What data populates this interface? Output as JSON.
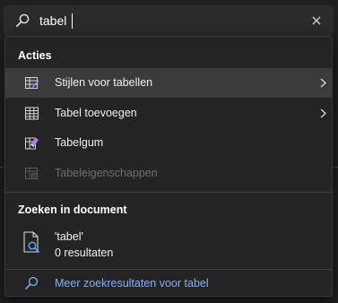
{
  "search": {
    "value": "tabel",
    "icon": "search-icon",
    "clear_icon": "close-icon"
  },
  "sections": {
    "actions_title": "Acties",
    "document_title": "Zoeken in document"
  },
  "actions": [
    {
      "label": "Stijlen voor tabellen",
      "icon": "table-styles-icon",
      "has_submenu": true,
      "hovered": true,
      "disabled": false
    },
    {
      "label": "Tabel toevoegen",
      "icon": "table-grid-icon",
      "has_submenu": true,
      "hovered": false,
      "disabled": false
    },
    {
      "label": "Tabelgum",
      "icon": "table-eraser-icon",
      "has_submenu": false,
      "hovered": false,
      "disabled": false
    },
    {
      "label": "Tabeleigenschappen",
      "icon": "table-properties-icon",
      "has_submenu": false,
      "hovered": false,
      "disabled": true
    }
  ],
  "document_result": {
    "query": "'tabel'",
    "count": "0 resultaten",
    "icon": "document-search-icon"
  },
  "more_results": {
    "label": "Meer zoekresultaten voor tabel",
    "icon": "search-icon"
  },
  "colors": {
    "accent": "#7eb3ff",
    "icon_purple": "#b07cf5",
    "icon_blue": "#5aa0ff",
    "hover": "#3b3b3b"
  }
}
